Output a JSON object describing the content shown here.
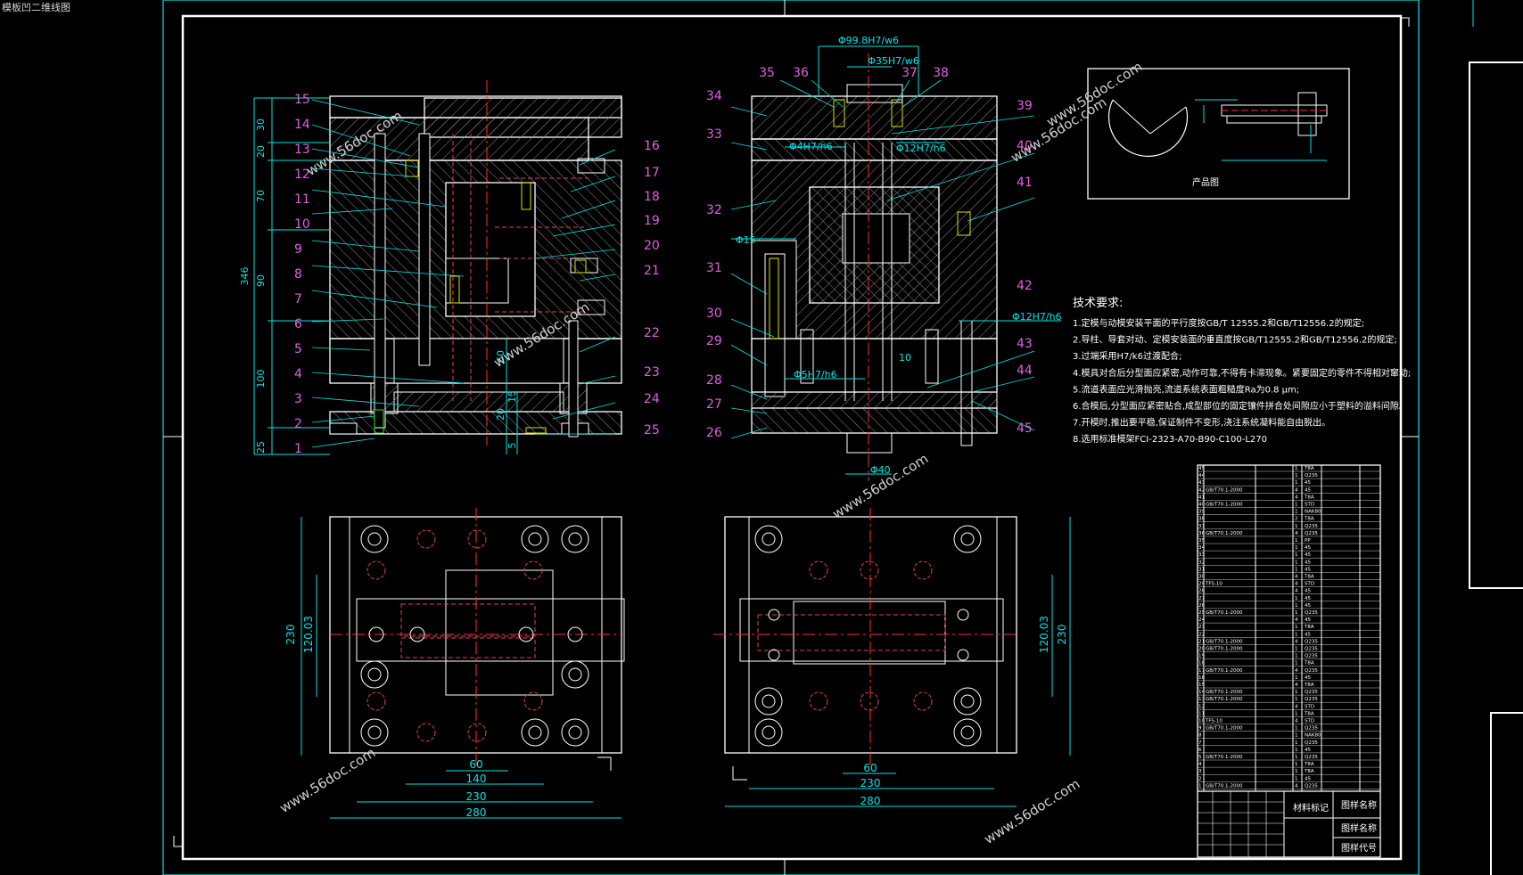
{
  "window": {
    "title": "模板凹二维线图"
  },
  "watermark": "www.56doc.com",
  "colors": {
    "background": "#000000",
    "frame": "#00e5e5",
    "outline": "#ffffff",
    "hatch": "#9a9a9a",
    "part_number": "#e060e0",
    "dimension": "#00e5e5",
    "center_line": "#ff3030",
    "hidden": "#e04060",
    "yellow": "#e0e000",
    "green": "#30e030",
    "watermark": "#d0d0d0"
  },
  "left_view": {
    "part_numbers": [
      "15",
      "14",
      "13",
      "12",
      "11",
      "10",
      "9",
      "8",
      "7",
      "6",
      "5",
      "4",
      "3",
      "2",
      "1"
    ],
    "right_numbers": [
      "16",
      "17",
      "18",
      "19",
      "20",
      "21",
      "22",
      "23",
      "24",
      "25"
    ],
    "dims_left": [
      "30",
      "20",
      "70",
      "346",
      "90",
      "100",
      "25"
    ],
    "dims_mid": [
      "60",
      "15",
      "20",
      "5"
    ]
  },
  "right_view": {
    "top_dims": [
      "Φ99.8H7/w6",
      "Φ35H7/w6"
    ],
    "top_numbers": [
      "35",
      "36",
      "37",
      "38"
    ],
    "left_numbers": [
      "34",
      "33",
      "32",
      "31",
      "30",
      "29",
      "28",
      "27",
      "26"
    ],
    "right_numbers": [
      "39",
      "40",
      "41",
      "42",
      "43",
      "44",
      "45"
    ],
    "labels": [
      "Φ4H7/h6",
      "Φ12H7/h6",
      "Φ15",
      "Φ5H7/h6",
      "Φ12H7/h6",
      "10",
      "Φ40"
    ]
  },
  "bottom_left_view": {
    "dims": [
      "230",
      "120.03",
      "60",
      "140",
      "230",
      "280"
    ]
  },
  "bottom_right_view": {
    "dims": [
      "120.03",
      "230",
      "60",
      "230",
      "280"
    ]
  },
  "product": {
    "caption": "产品图"
  },
  "tech_requirements": {
    "title": "技术要求:",
    "items": [
      "1.定模与动模安装平面的平行度按GB/T 12555.2和GB/T12556.2的规定;",
      "2.导柱、导套对动、定模安装面的垂直度按GB/T12555.2和GB/T12556.2的规定;",
      "3.过端采用H7/k6过渡配合;",
      "4.模具对合后分型面应紧密,动作可靠,不得有卡滞现象。紧要固定的零件不得相对窜动;",
      "5.流道表面应光滑抛亮,流道系统表面粗糙度Ra为0.8 μm;",
      "6.合模后,分型面应紧密贴合,成型部位的固定镶件拼合处间隙应小于塑料的溢料间隙。",
      "7.开模时,推出要平稳,保证制件不变形,浇注系统凝料能自由脱出。",
      "8.选用标准模架FCI-2323-A70-B90-C100-L270"
    ]
  },
  "bom_title_block": {
    "material_mark": "材料标记",
    "drawing_name_1": "图样名称",
    "drawing_name_2": "图样名称",
    "drawing_code": "图样代号"
  },
  "bom_rows": [
    [
      "45",
      "",
      "1",
      "T8A"
    ],
    [
      "44",
      "",
      "1",
      "Q235"
    ],
    [
      "43",
      "",
      "1",
      "45"
    ],
    [
      "42",
      "GB/T70.1-2000",
      "4",
      "45"
    ],
    [
      "41",
      "",
      "4",
      "T8A"
    ],
    [
      "40",
      "GB/T70.1-2000",
      "1",
      "STD"
    ],
    [
      "39",
      "",
      "1",
      "NAK80"
    ],
    [
      "38",
      "",
      "2",
      "T8A"
    ],
    [
      "37",
      "",
      "1",
      "Q235"
    ],
    [
      "36",
      "GB/T70.1-2000",
      "4",
      "Q235"
    ],
    [
      "35",
      "",
      "1",
      "PP"
    ],
    [
      "34",
      "",
      "1",
      "45"
    ],
    [
      "33",
      "",
      "1",
      "45"
    ],
    [
      "32",
      "",
      "1",
      "45"
    ],
    [
      "31",
      "",
      "1",
      "45"
    ],
    [
      "30",
      "",
      "4",
      "T8A"
    ],
    [
      "29",
      "TFS-10",
      "4",
      "STD"
    ],
    [
      "28",
      "",
      "4",
      "45"
    ],
    [
      "27",
      "",
      "1",
      "45"
    ],
    [
      "26",
      "",
      "1",
      "45"
    ],
    [
      "25",
      "GB/T70.1-2000",
      "1",
      "Q235"
    ],
    [
      "24",
      "",
      "4",
      "45"
    ],
    [
      "23",
      "",
      "1",
      "T8A"
    ],
    [
      "22",
      "",
      "1",
      "45"
    ],
    [
      "21",
      "GB/T70.1-2000",
      "4",
      "Q235"
    ],
    [
      "20",
      "GB/T70.1-2000",
      "1",
      "Q235"
    ],
    [
      "19",
      "",
      "1",
      "Q235"
    ],
    [
      "18",
      "",
      "1",
      "T8A"
    ],
    [
      "17",
      "GB/T70.1-2000",
      "4",
      "Q235"
    ],
    [
      "16",
      "",
      "1",
      "45"
    ],
    [
      "15",
      "",
      "4",
      "T8A"
    ],
    [
      "14",
      "GB/T70.1-2000",
      "1",
      "Q235"
    ],
    [
      "13",
      "GB/T70.1-2000",
      "1",
      "Q235"
    ],
    [
      "12",
      "",
      "4",
      "STD"
    ],
    [
      "11",
      "",
      "1",
      "T8A"
    ],
    [
      "10",
      "TFS-10",
      "4",
      "STD"
    ],
    [
      "9",
      "GB/T70.1-2000",
      "1",
      "Q235"
    ],
    [
      "8",
      "",
      "1",
      "NAK80"
    ],
    [
      "7",
      "",
      "1",
      "Q235"
    ],
    [
      "6",
      "",
      "1",
      "45"
    ],
    [
      "5",
      "GB/T70.1-2000",
      "1",
      "Q235"
    ],
    [
      "4",
      "",
      "1",
      "T8A"
    ],
    [
      "3",
      "",
      "1",
      "T8A"
    ],
    [
      "2",
      "",
      "1",
      "45"
    ],
    [
      "1",
      "GB/T70.1-2000",
      "4",
      "Q235"
    ]
  ]
}
